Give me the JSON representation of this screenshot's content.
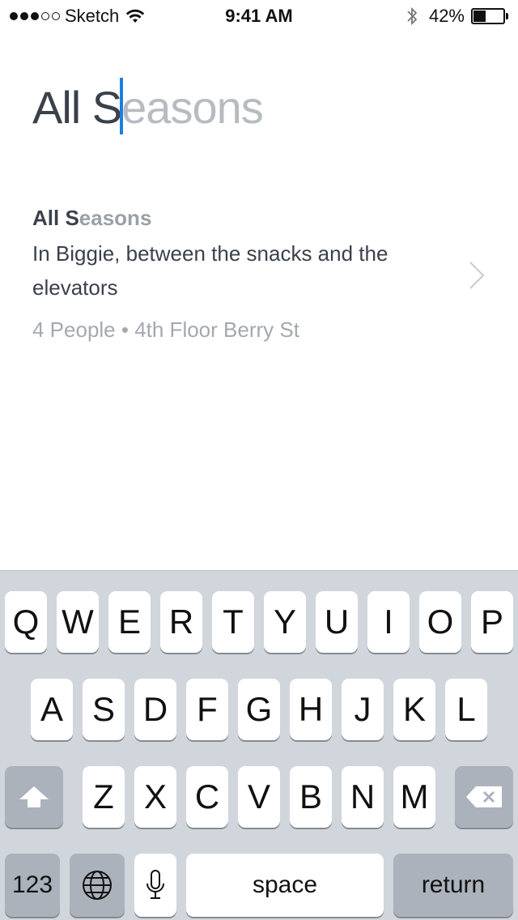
{
  "status_bar": {
    "carrier": "Sketch",
    "time": "9:41 AM",
    "battery": "42%",
    "signal_bars_filled": 3,
    "signal_bars_total": 5,
    "battery_level": 0.42
  },
  "search": {
    "typed": "All S",
    "suggestion": "easons"
  },
  "result": {
    "title_typed": "All S",
    "title_rest": "easons",
    "description": "In Biggie, between the snacks and the elevators",
    "meta": "4 People • 4th Floor Berry St"
  },
  "keyboard": {
    "row1": [
      "Q",
      "W",
      "E",
      "R",
      "T",
      "Y",
      "U",
      "I",
      "O",
      "P"
    ],
    "row2": [
      "A",
      "S",
      "D",
      "F",
      "G",
      "H",
      "J",
      "K",
      "L"
    ],
    "row3": [
      "Z",
      "X",
      "C",
      "V",
      "B",
      "N",
      "M"
    ],
    "numbers_label": "123",
    "space_label": "space",
    "return_label": "return"
  },
  "colors": {
    "caret": "#1a7ee6",
    "keyboard_bg": "#d1d5dc",
    "key_dark": "#abb2bc"
  }
}
